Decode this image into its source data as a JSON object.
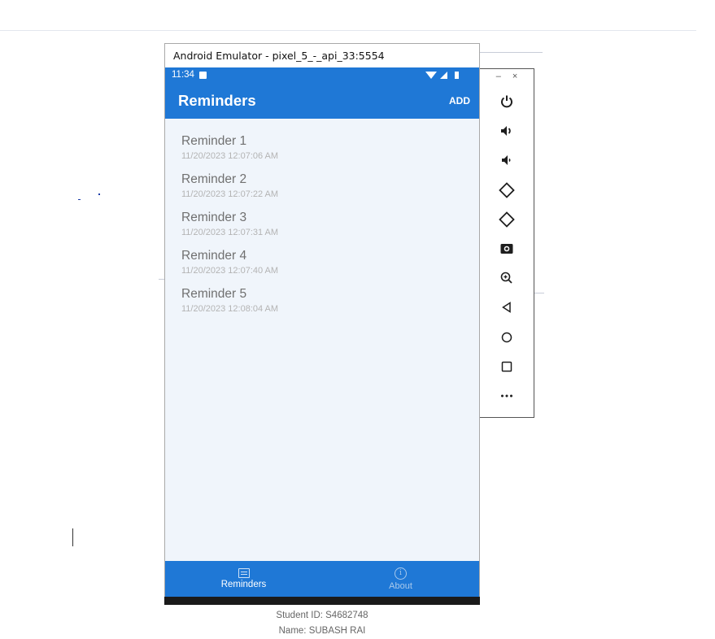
{
  "window": {
    "title": "Android Emulator - pixel_5_-_api_33:5554"
  },
  "status_bar": {
    "time": "11:34"
  },
  "app_bar": {
    "title": "Reminders",
    "add_label": "ADD"
  },
  "reminders": [
    {
      "title": "Reminder 1",
      "date": "11/20/2023 12:07:06 AM"
    },
    {
      "title": "Reminder 2",
      "date": "11/20/2023 12:07:22 AM"
    },
    {
      "title": "Reminder 3",
      "date": "11/20/2023 12:07:31 AM"
    },
    {
      "title": "Reminder 4",
      "date": "11/20/2023 12:07:40 AM"
    },
    {
      "title": "Reminder 5",
      "date": "11/20/2023 12:08:04 AM"
    }
  ],
  "footer": {
    "student_id": "Student ID: S4682748",
    "name": "Name: SUBASH RAI"
  },
  "bottom_nav": {
    "reminders_label": "Reminders",
    "about_label": "About",
    "about_icon_glyph": "i"
  },
  "side_panel": {
    "minimize_glyph": "–",
    "close_glyph": "×",
    "buttons": [
      "power-icon",
      "volume-up-icon",
      "volume-down-icon",
      "rotate-left-icon",
      "rotate-right-icon",
      "camera-icon",
      "zoom-icon",
      "back-icon",
      "home-icon",
      "overview-icon",
      "more-icon"
    ]
  },
  "colors": {
    "primary": "#1f78d6",
    "content_bg": "#f0f5fb",
    "title_text": "#707070",
    "date_text": "#b4b4b4"
  }
}
